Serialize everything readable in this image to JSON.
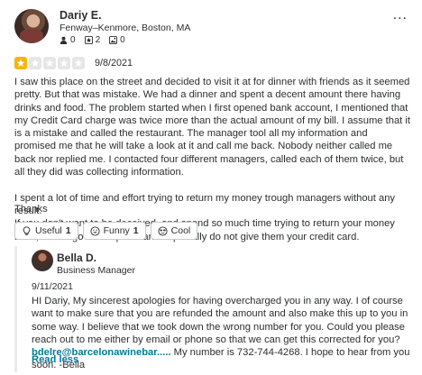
{
  "user": {
    "name": "Dariy E.",
    "location": "Fenway–Kenmore, Boston, MA",
    "friends": "0",
    "reviews": "2",
    "photos": "0"
  },
  "review": {
    "rating": 1,
    "date": "9/8/2021",
    "text": "I saw this place on the street and decided to visit it at for dinner with friends as it seemed pretty. But that was mistake. We had a dinner and spent a decent amount there having drinks and food. The problem started when I first opened bank account, I mentioned that my Credit Card charge was twice more than the actual amount of my bill. I assume that it is a mistake and called the restaurant. The manager tool all my information and promised me that he will take a look at it and call me back. Nobody neither called me back nor replied me. I contacted four different managers, called each of them twice, but all they did was collecting information.\n\nI spent a lot of time and effort trying to return my money trough managers without any result.\nIf you don't want to be deceived, and spend so much time trying to return your money back, do not go to this place and especially do not give them your credit card.",
    "thanks": "Thanks"
  },
  "reactions": {
    "useful_label": "Useful",
    "useful_count": "1",
    "funny_label": "Funny",
    "funny_count": "1",
    "cool_label": "Cool"
  },
  "owner_reply": {
    "name": "Bella D.",
    "role": "Business Manager",
    "date": "9/11/2021",
    "text_before_email": "HI Dariy, My sincerest apologies for having overcharged you in any way. I of course want to make sure that you are refunded the amount and also make this up to you in some way. I believe that we took down the wrong number for you. Could you please reach out to me either by email or phone so that we can get this corrected for you? ",
    "email": "bdelre@barcelonawinebar.....",
    "text_after_email": " My number is 732-744-4268. I hope to hear from you soon. -Bella",
    "read_less": "Read less"
  },
  "more_menu": "..."
}
